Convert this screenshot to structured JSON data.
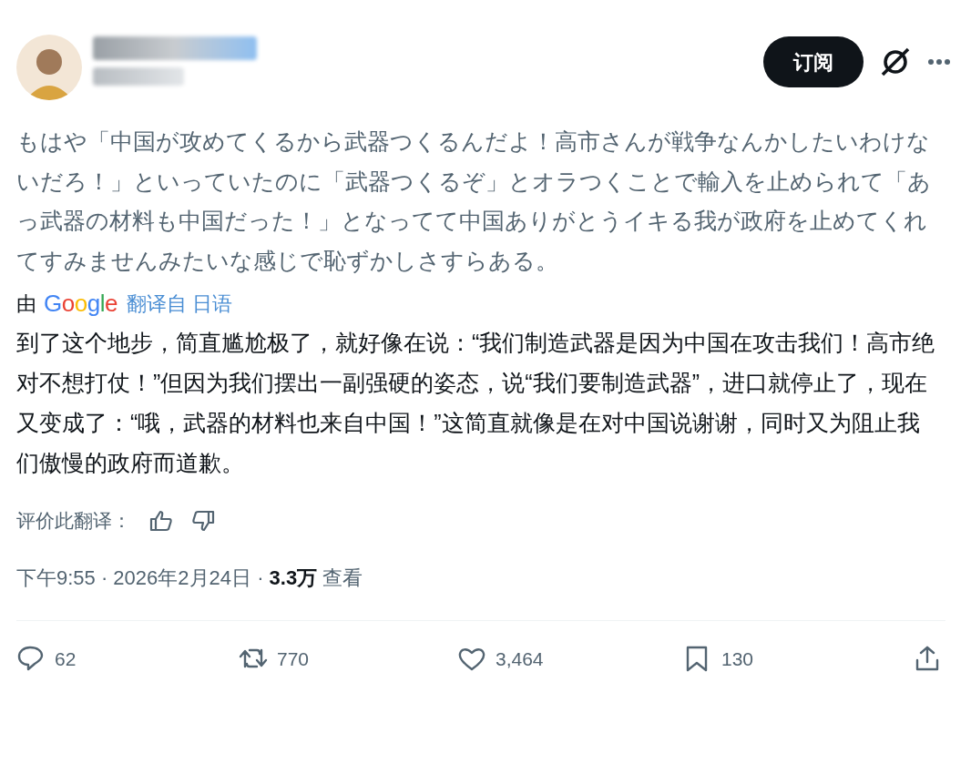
{
  "header": {
    "subscribe_button": "订阅"
  },
  "post": {
    "original_text": "もはや「中国が攻めてくるから武器つくるんだよ！高市さんが戦争なんかしたいわけないだろ！」といっていたのに「武器つくるぞ」とオラつくことで輸入を止められて「あっ武器の材料も中国だった！」となってて中国ありがとうイキる我が政府を止めてくれてすみませんみたいな感じで恥ずかしさすらある。",
    "translation_by": "由",
    "translation_provider": "Google",
    "translation_source": "翻译自 日语",
    "translated_text": "到了这个地步，简直尴尬极了，就好像在说：“我们制造武器是因为中国在攻击我们！高市绝对不想打仗！”但因为我们摆出一副强硬的姿态，说“我们要制造武器”，进口就停止了，现在又变成了：“哦，武器的材料也来自中国！”这简直就像是在对中国说谢谢，同时又为阻止我们傲慢的政府而道歉。",
    "rate_translation": "评价此翻译：",
    "meta": "下午9:55 · 2026年2月24日 · **3.3万** 查看"
  },
  "actions": [
    {
      "kind": "reply",
      "count": "62"
    },
    {
      "kind": "repost",
      "count": "770"
    },
    {
      "kind": "like",
      "count": "3,464"
    },
    {
      "kind": "bookmark",
      "count": "130"
    },
    {
      "kind": "share"
    }
  ]
}
